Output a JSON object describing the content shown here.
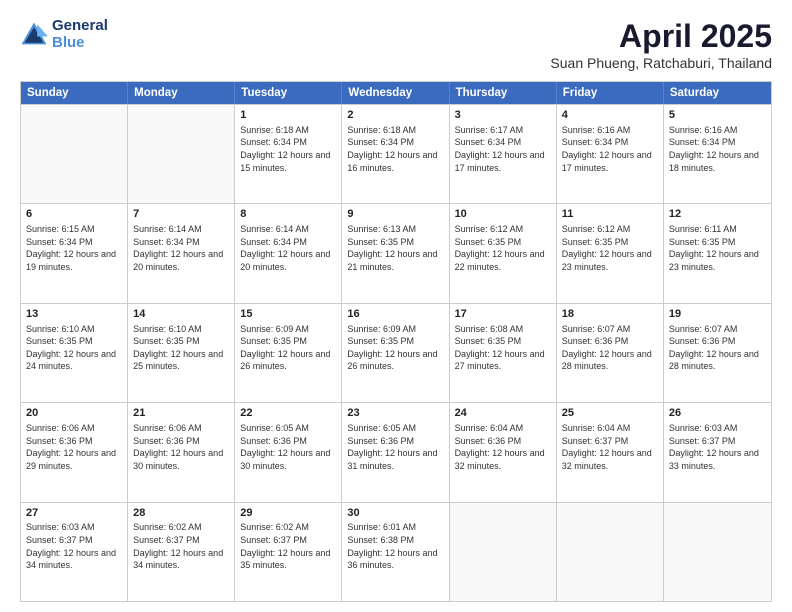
{
  "logo": {
    "general": "General",
    "blue": "Blue"
  },
  "title": "April 2025",
  "subtitle": "Suan Phueng, Ratchaburi, Thailand",
  "days_of_week": [
    "Sunday",
    "Monday",
    "Tuesday",
    "Wednesday",
    "Thursday",
    "Friday",
    "Saturday"
  ],
  "weeks": [
    [
      {
        "day": "",
        "sunrise": "",
        "sunset": "",
        "daylight": ""
      },
      {
        "day": "",
        "sunrise": "",
        "sunset": "",
        "daylight": ""
      },
      {
        "day": "1",
        "sunrise": "Sunrise: 6:18 AM",
        "sunset": "Sunset: 6:34 PM",
        "daylight": "Daylight: 12 hours and 15 minutes."
      },
      {
        "day": "2",
        "sunrise": "Sunrise: 6:18 AM",
        "sunset": "Sunset: 6:34 PM",
        "daylight": "Daylight: 12 hours and 16 minutes."
      },
      {
        "day": "3",
        "sunrise": "Sunrise: 6:17 AM",
        "sunset": "Sunset: 6:34 PM",
        "daylight": "Daylight: 12 hours and 17 minutes."
      },
      {
        "day": "4",
        "sunrise": "Sunrise: 6:16 AM",
        "sunset": "Sunset: 6:34 PM",
        "daylight": "Daylight: 12 hours and 17 minutes."
      },
      {
        "day": "5",
        "sunrise": "Sunrise: 6:16 AM",
        "sunset": "Sunset: 6:34 PM",
        "daylight": "Daylight: 12 hours and 18 minutes."
      }
    ],
    [
      {
        "day": "6",
        "sunrise": "Sunrise: 6:15 AM",
        "sunset": "Sunset: 6:34 PM",
        "daylight": "Daylight: 12 hours and 19 minutes."
      },
      {
        "day": "7",
        "sunrise": "Sunrise: 6:14 AM",
        "sunset": "Sunset: 6:34 PM",
        "daylight": "Daylight: 12 hours and 20 minutes."
      },
      {
        "day": "8",
        "sunrise": "Sunrise: 6:14 AM",
        "sunset": "Sunset: 6:34 PM",
        "daylight": "Daylight: 12 hours and 20 minutes."
      },
      {
        "day": "9",
        "sunrise": "Sunrise: 6:13 AM",
        "sunset": "Sunset: 6:35 PM",
        "daylight": "Daylight: 12 hours and 21 minutes."
      },
      {
        "day": "10",
        "sunrise": "Sunrise: 6:12 AM",
        "sunset": "Sunset: 6:35 PM",
        "daylight": "Daylight: 12 hours and 22 minutes."
      },
      {
        "day": "11",
        "sunrise": "Sunrise: 6:12 AM",
        "sunset": "Sunset: 6:35 PM",
        "daylight": "Daylight: 12 hours and 23 minutes."
      },
      {
        "day": "12",
        "sunrise": "Sunrise: 6:11 AM",
        "sunset": "Sunset: 6:35 PM",
        "daylight": "Daylight: 12 hours and 23 minutes."
      }
    ],
    [
      {
        "day": "13",
        "sunrise": "Sunrise: 6:10 AM",
        "sunset": "Sunset: 6:35 PM",
        "daylight": "Daylight: 12 hours and 24 minutes."
      },
      {
        "day": "14",
        "sunrise": "Sunrise: 6:10 AM",
        "sunset": "Sunset: 6:35 PM",
        "daylight": "Daylight: 12 hours and 25 minutes."
      },
      {
        "day": "15",
        "sunrise": "Sunrise: 6:09 AM",
        "sunset": "Sunset: 6:35 PM",
        "daylight": "Daylight: 12 hours and 26 minutes."
      },
      {
        "day": "16",
        "sunrise": "Sunrise: 6:09 AM",
        "sunset": "Sunset: 6:35 PM",
        "daylight": "Daylight: 12 hours and 26 minutes."
      },
      {
        "day": "17",
        "sunrise": "Sunrise: 6:08 AM",
        "sunset": "Sunset: 6:35 PM",
        "daylight": "Daylight: 12 hours and 27 minutes."
      },
      {
        "day": "18",
        "sunrise": "Sunrise: 6:07 AM",
        "sunset": "Sunset: 6:36 PM",
        "daylight": "Daylight: 12 hours and 28 minutes."
      },
      {
        "day": "19",
        "sunrise": "Sunrise: 6:07 AM",
        "sunset": "Sunset: 6:36 PM",
        "daylight": "Daylight: 12 hours and 28 minutes."
      }
    ],
    [
      {
        "day": "20",
        "sunrise": "Sunrise: 6:06 AM",
        "sunset": "Sunset: 6:36 PM",
        "daylight": "Daylight: 12 hours and 29 minutes."
      },
      {
        "day": "21",
        "sunrise": "Sunrise: 6:06 AM",
        "sunset": "Sunset: 6:36 PM",
        "daylight": "Daylight: 12 hours and 30 minutes."
      },
      {
        "day": "22",
        "sunrise": "Sunrise: 6:05 AM",
        "sunset": "Sunset: 6:36 PM",
        "daylight": "Daylight: 12 hours and 30 minutes."
      },
      {
        "day": "23",
        "sunrise": "Sunrise: 6:05 AM",
        "sunset": "Sunset: 6:36 PM",
        "daylight": "Daylight: 12 hours and 31 minutes."
      },
      {
        "day": "24",
        "sunrise": "Sunrise: 6:04 AM",
        "sunset": "Sunset: 6:36 PM",
        "daylight": "Daylight: 12 hours and 32 minutes."
      },
      {
        "day": "25",
        "sunrise": "Sunrise: 6:04 AM",
        "sunset": "Sunset: 6:37 PM",
        "daylight": "Daylight: 12 hours and 32 minutes."
      },
      {
        "day": "26",
        "sunrise": "Sunrise: 6:03 AM",
        "sunset": "Sunset: 6:37 PM",
        "daylight": "Daylight: 12 hours and 33 minutes."
      }
    ],
    [
      {
        "day": "27",
        "sunrise": "Sunrise: 6:03 AM",
        "sunset": "Sunset: 6:37 PM",
        "daylight": "Daylight: 12 hours and 34 minutes."
      },
      {
        "day": "28",
        "sunrise": "Sunrise: 6:02 AM",
        "sunset": "Sunset: 6:37 PM",
        "daylight": "Daylight: 12 hours and 34 minutes."
      },
      {
        "day": "29",
        "sunrise": "Sunrise: 6:02 AM",
        "sunset": "Sunset: 6:37 PM",
        "daylight": "Daylight: 12 hours and 35 minutes."
      },
      {
        "day": "30",
        "sunrise": "Sunrise: 6:01 AM",
        "sunset": "Sunset: 6:38 PM",
        "daylight": "Daylight: 12 hours and 36 minutes."
      },
      {
        "day": "",
        "sunrise": "",
        "sunset": "",
        "daylight": ""
      },
      {
        "day": "",
        "sunrise": "",
        "sunset": "",
        "daylight": ""
      },
      {
        "day": "",
        "sunrise": "",
        "sunset": "",
        "daylight": ""
      }
    ]
  ]
}
